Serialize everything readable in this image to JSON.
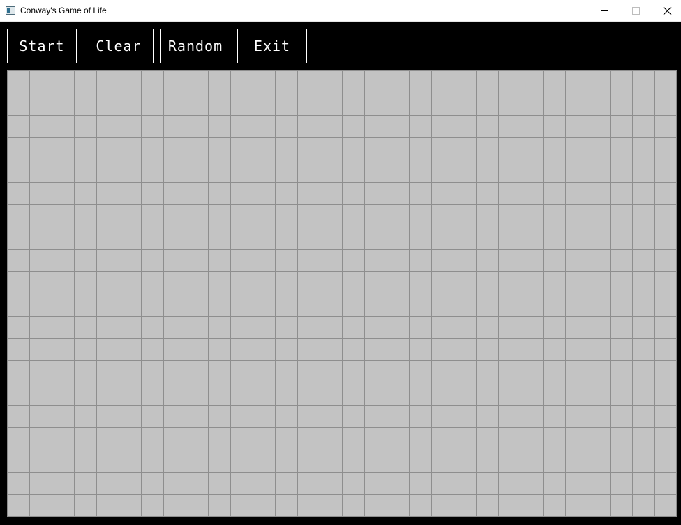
{
  "window": {
    "title": "Conway's Game of Life",
    "icon": "app-window-icon",
    "controls": [
      "minimize-icon",
      "maximize-icon",
      "close-icon"
    ]
  },
  "toolbar": {
    "start_label": "Start",
    "clear_label": "Clear",
    "random_label": "Random",
    "exit_label": "Exit"
  },
  "grid": {
    "columns": 30,
    "rows": 20,
    "live_cells": [],
    "colors": {
      "cell": "#c3c3c3",
      "line": "#8e8e8e",
      "background": "#000000"
    }
  }
}
